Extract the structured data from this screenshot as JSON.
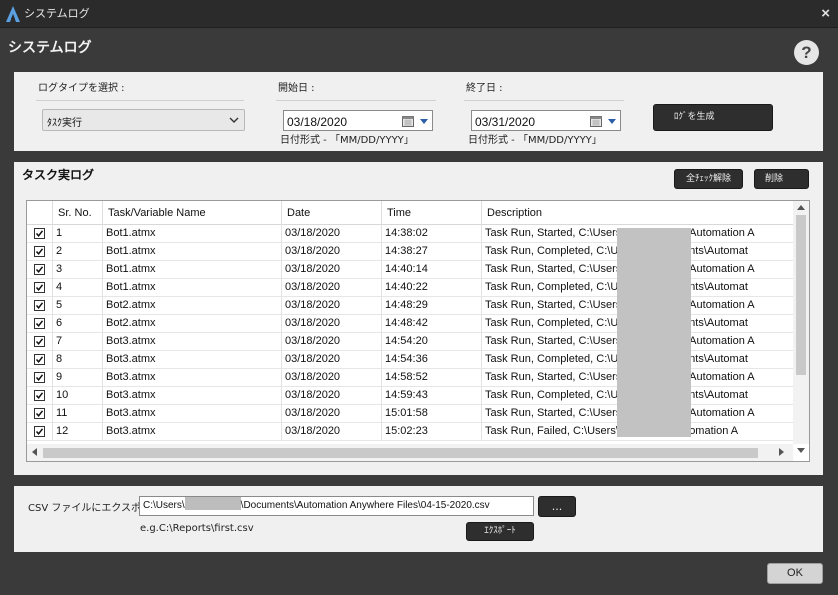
{
  "window": {
    "title": "システムログ",
    "close_label": "×"
  },
  "header": {
    "title": "システムログ",
    "help_label": "?"
  },
  "filters": {
    "log_type_label": "ログタイプを選択 :",
    "log_type_value": "ﾀｽｸ実行",
    "start_label": "開始日 :",
    "start_value": "03/18/2020",
    "start_format": "日付形式 - 「MM/DD/YYYY」",
    "end_label": "終了日 :",
    "end_value": "03/31/2020",
    "end_format": "日付形式 - 「MM/DD/YYYY」",
    "generate_label": "ﾛｸﾞを生成"
  },
  "log": {
    "title": "タスク実ログ",
    "uncheck_all_label": "全ﾁｪｯｸ解除",
    "delete_label": "削除",
    "columns": [
      "Sr. No.",
      "Task/Variable Name",
      "Date",
      "Time",
      "Description"
    ],
    "rows": [
      {
        "sr": "1",
        "task": "Bot1.atmx",
        "date": "03/18/2020",
        "time": "14:38:02",
        "desc": "Task Run, Started, C:\\Users\\                   \\Documents\\Automation A"
      },
      {
        "sr": "2",
        "task": "Bot1.atmx",
        "date": "03/18/2020",
        "time": "14:38:27",
        "desc": "Task Run, Completed, C:\\Users\\                   \\Documents\\Automat"
      },
      {
        "sr": "3",
        "task": "Bot1.atmx",
        "date": "03/18/2020",
        "time": "14:40:14",
        "desc": "Task Run, Started, C:\\Users\\                   \\Documents\\Automation A"
      },
      {
        "sr": "4",
        "task": "Bot1.atmx",
        "date": "03/18/2020",
        "time": "14:40:22",
        "desc": "Task Run, Completed, C:\\Users\\                   \\Documents\\Automat"
      },
      {
        "sr": "5",
        "task": "Bot2.atmx",
        "date": "03/18/2020",
        "time": "14:48:29",
        "desc": "Task Run, Started, C:\\Users\\                   \\Documents\\Automation A"
      },
      {
        "sr": "6",
        "task": "Bot2.atmx",
        "date": "03/18/2020",
        "time": "14:48:42",
        "desc": "Task Run, Completed, C:\\Users\\                   \\Documents\\Automat"
      },
      {
        "sr": "7",
        "task": "Bot3.atmx",
        "date": "03/18/2020",
        "time": "14:54:20",
        "desc": "Task Run, Started, C:\\Users\\                   \\Documents\\Automation A"
      },
      {
        "sr": "8",
        "task": "Bot3.atmx",
        "date": "03/18/2020",
        "time": "14:54:36",
        "desc": "Task Run, Completed, C:\\Users\\                   \\Documents\\Automat"
      },
      {
        "sr": "9",
        "task": "Bot3.atmx",
        "date": "03/18/2020",
        "time": "14:58:52",
        "desc": "Task Run, Started, C:\\Users\\                   \\Documents\\Automation A"
      },
      {
        "sr": "10",
        "task": "Bot3.atmx",
        "date": "03/18/2020",
        "time": "14:59:43",
        "desc": "Task Run, Completed, C:\\Users\\                   \\Documents\\Automat"
      },
      {
        "sr": "11",
        "task": "Bot3.atmx",
        "date": "03/18/2020",
        "time": "15:01:58",
        "desc": "Task Run, Started, C:\\Users\\                   \\Documents\\Automation A"
      },
      {
        "sr": "12",
        "task": "Bot3.atmx",
        "date": "03/18/2020",
        "time": "15:02:23",
        "desc": "Task Run, Failed, C:\\Users\\                   ocuments\\Automation A"
      }
    ]
  },
  "export": {
    "label": "CSV ファイルにエクスポ :",
    "path_prefix": "C:\\Users\\",
    "path_suffix": "\\Documents\\Automation Anywhere Files\\04-15-2020.csv",
    "browse_label": "...",
    "example": "e.g.C:\\Reports\\first.csv",
    "export_label": "ｴｸｽﾎﾟｰﾄ"
  },
  "footer": {
    "ok_label": "OK"
  },
  "colors": {
    "window_bg": "#3a3a3a",
    "panel_bg": "#f0f0f0",
    "button_dark": "#2e2e2e",
    "accent_blue": "#2c5fa8"
  }
}
